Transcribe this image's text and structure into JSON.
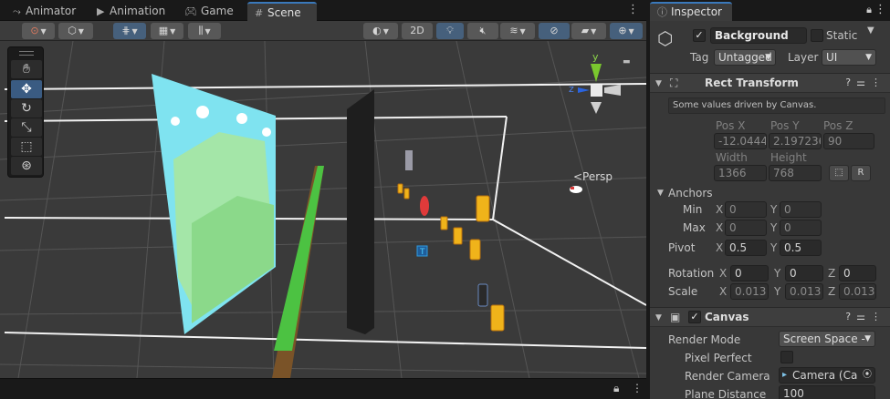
{
  "scene_tabs": [
    {
      "label": "Animator",
      "icon": "animator-icon"
    },
    {
      "label": "Animation",
      "icon": "animation-icon"
    },
    {
      "label": "Game",
      "icon": "gamepad-icon"
    },
    {
      "label": "Scene",
      "icon": "hash-icon"
    }
  ],
  "scene_toolbar": {
    "mode_2d": "2D"
  },
  "scene_tools": [
    "hand-tool",
    "move-tool",
    "rotate-tool",
    "scale-tool",
    "rect-tool",
    "transform-tool"
  ],
  "gizmo": {
    "axis_y": "y",
    "axis_z": "z",
    "projection": "<Persp"
  },
  "inspector": {
    "tab_label": "Inspector",
    "object": {
      "active": true,
      "name": "Background",
      "static_label": "Static",
      "static": false,
      "tag_label": "Tag",
      "tag_value": "Untagged",
      "layer_label": "Layer",
      "layer_value": "UI"
    },
    "rect_transform": {
      "title": "Rect Transform",
      "note": "Some values driven by Canvas.",
      "pos_x_label": "Pos X",
      "pos_y_label": "Pos Y",
      "pos_z_label": "Pos Z",
      "pos_x": "-12.0444",
      "pos_y": "2.197236",
      "pos_z": "90",
      "width_label": "Width",
      "height_label": "Height",
      "width": "1366",
      "height": "768",
      "r_button": "R",
      "anchors_label": "Anchors",
      "min_label": "Min",
      "max_label": "Max",
      "min_x": "0",
      "min_y": "0",
      "max_x": "0",
      "max_y": "0",
      "pivot_label": "Pivot",
      "pivot_x": "0.5",
      "pivot_y": "0.5",
      "rotation_label": "Rotation",
      "rot_x": "0",
      "rot_y": "0",
      "rot_z": "0",
      "scale_label": "Scale",
      "scale_x": "0.013",
      "scale_y": "0.013",
      "scale_z": "0.013",
      "x": "X",
      "y": "Y",
      "z": "Z"
    },
    "canvas": {
      "title": "Canvas",
      "enabled": true,
      "render_mode_label": "Render Mode",
      "render_mode_value": "Screen Space -",
      "pixel_perfect_label": "Pixel Perfect",
      "render_camera_label": "Render Camera",
      "render_camera_value": "Camera (Ca",
      "plane_distance_label": "Plane Distance",
      "plane_distance_value": "100"
    }
  },
  "colors": {
    "accent": "#3a79bb",
    "selected_tool": "#3a5b82",
    "panel": "#383838",
    "viewport": "#3a3a3a"
  }
}
